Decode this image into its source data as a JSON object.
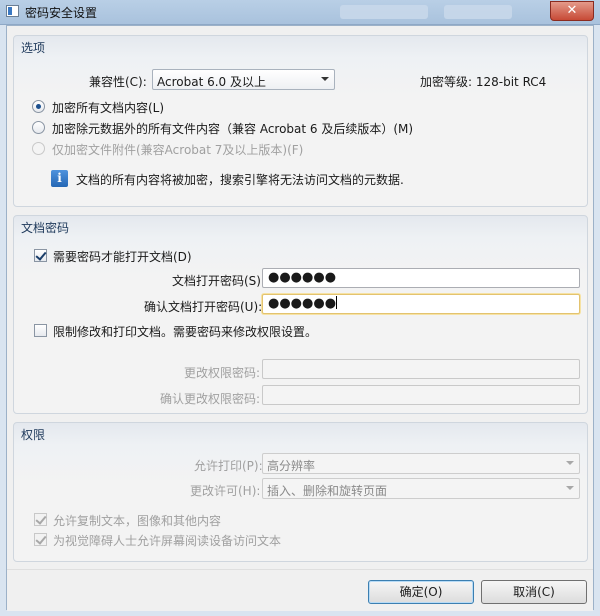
{
  "window": {
    "title": "密码安全设置",
    "close_glyph": "✕"
  },
  "options": {
    "group_title": "选项",
    "compat_label": "兼容性(C):",
    "compat_value": "Acrobat 6.0 及以上",
    "encryption_level": "加密等级: 128-bit RC4",
    "radios": [
      {
        "label": "加密所有文档内容(L)",
        "selected": true,
        "disabled": false
      },
      {
        "label": "加密除元数据外的所有文件内容（兼容 Acrobat 6 及后续版本）(M)",
        "selected": false,
        "disabled": false
      },
      {
        "label": "仅加密文件附件(兼容Acrobat 7及以上版本)(F)",
        "selected": false,
        "disabled": true
      }
    ],
    "info_text": "文档的所有内容将被加密，搜索引擎将无法访问文档的元数据.",
    "info_glyph": "i"
  },
  "doc_password": {
    "group_title": "文档密码",
    "require_label": "需要密码才能打开文档(D)",
    "require_checked": true,
    "open_pw_label": "文档打开密码(S):",
    "open_pw_value": "●●●●●●",
    "confirm_pw_label": "确认文档打开密码(U):",
    "confirm_pw_value": "●●●●●●",
    "restrict_label": "限制修改和打印文档。需要密码来修改权限设置。",
    "restrict_checked": false,
    "perm_pw_label": "更改权限密码:",
    "confirm_perm_pw_label": "确认更改权限密码:"
  },
  "permissions": {
    "group_title": "权限",
    "print_label": "允许打印(P):",
    "print_value": "高分辨率",
    "change_label": "更改许可(H):",
    "change_value": "插入、删除和旋转页面",
    "copy_label": "允许复制文本，图像和其他内容",
    "copy_checked": true,
    "screenreader_label": "为视觉障碍人士允许屏幕阅读设备访问文本",
    "screenreader_checked": true
  },
  "buttons": {
    "ok": "确定(O)",
    "cancel": "取消(C)"
  },
  "colors": {
    "title_bar": "#a9c2dd",
    "close_button": "#c74a36",
    "accent": "#1b4f8e",
    "info_icon": "#2466b4"
  }
}
